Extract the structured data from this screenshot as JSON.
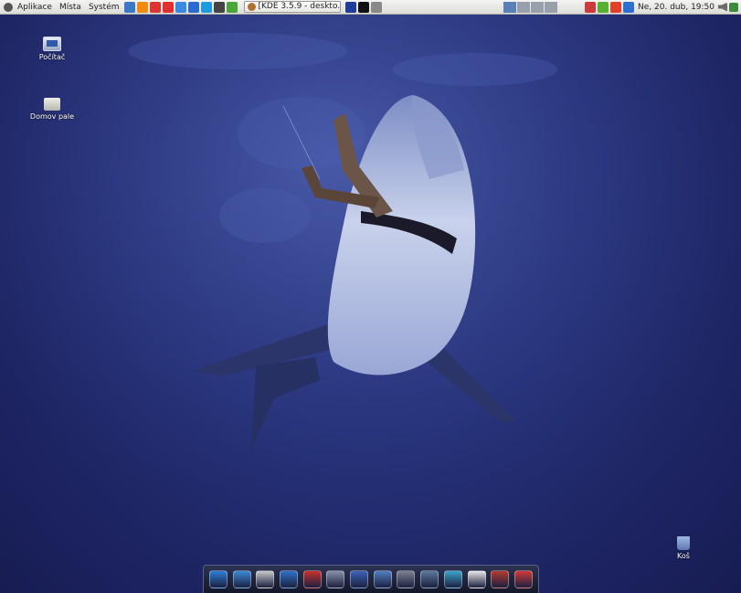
{
  "top_panel": {
    "menus": [
      "Aplikace",
      "Místa",
      "Systém"
    ],
    "launchers": [
      {
        "name": "text-editor-icon",
        "color": "#3a79c7"
      },
      {
        "name": "vlc-cone-icon",
        "color": "#f08a10"
      },
      {
        "name": "network-icon",
        "color": "#d33"
      },
      {
        "name": "puzzle-icon",
        "color": "#e03030"
      },
      {
        "name": "users-icon",
        "color": "#3b89e0"
      },
      {
        "name": "globe-blue-icon",
        "color": "#2a6bd0"
      },
      {
        "name": "skype-icon",
        "color": "#1c9bdf"
      },
      {
        "name": "terminal-icon",
        "color": "#444"
      },
      {
        "name": "globe-green-icon",
        "color": "#4aa53a"
      }
    ],
    "task_label": "[KDE 3.5.9 - deskto...",
    "active_workspace": 1,
    "tray_icons": [
      {
        "name": "monitor-tray-icon",
        "color": "#1f3e9a"
      },
      {
        "name": "black-window-tray-icon",
        "color": "#111"
      },
      {
        "name": "sparkle-tray-icon",
        "color": "#8a8a8a"
      }
    ],
    "status_icons": [
      {
        "name": "alarm-clock-icon",
        "color": "#cc3b3b"
      },
      {
        "name": "messenger-icon",
        "color": "#58b030"
      },
      {
        "name": "update-icon",
        "color": "#e0402a"
      },
      {
        "name": "network-status-icon",
        "color": "#2d6fd2"
      }
    ],
    "clock": "Ne, 20. dub, 19:50"
  },
  "desktop_icons": [
    {
      "label": "Počítač"
    },
    {
      "label": "Domov pale"
    },
    {
      "label": "Koš"
    }
  ],
  "dock": [
    {
      "name": "desktop-dock-icon",
      "color": "#2e7fd6"
    },
    {
      "name": "monitors-dock-icon",
      "color": "#3d8ad8"
    },
    {
      "name": "files-dock-icon",
      "color": "#c9c9c9"
    },
    {
      "name": "browser-globe-dock-icon",
      "color": "#2f72c9"
    },
    {
      "name": "pdf-reader-dock-icon",
      "color": "#c7322d"
    },
    {
      "name": "disc-dock-icon",
      "color": "#8a8fa8"
    },
    {
      "name": "media-dock-icon",
      "color": "#3c63b8"
    },
    {
      "name": "network-dock-icon",
      "color": "#507fc0"
    },
    {
      "name": "speaker-dock-icon",
      "color": "#7d8190"
    },
    {
      "name": "image-viewer-dock-icon",
      "color": "#59789c"
    },
    {
      "name": "photos-dock-icon",
      "color": "#3ba4c9"
    },
    {
      "name": "writer-dock-icon",
      "color": "#e9e9e9"
    },
    {
      "name": "tools-dock-icon",
      "color": "#b33a2e"
    },
    {
      "name": "music-dock-icon",
      "color": "#d23a3a"
    }
  ]
}
